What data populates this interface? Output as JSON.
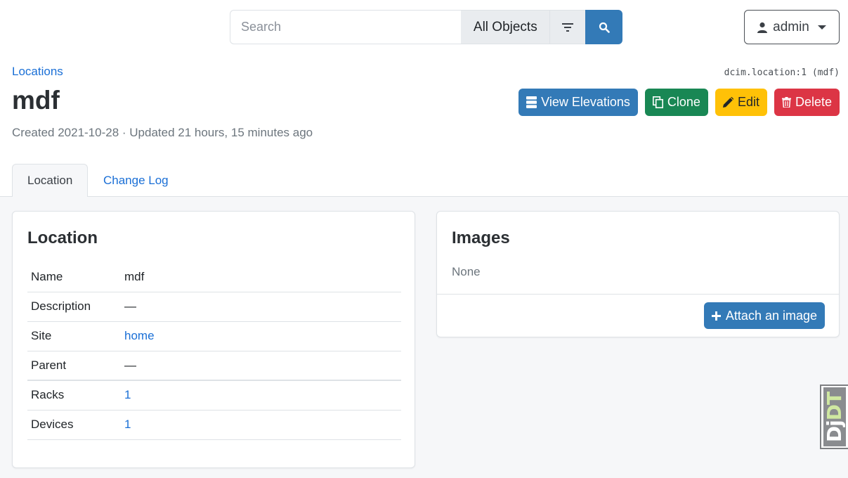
{
  "search": {
    "placeholder": "Search",
    "scope_label": "All Objects"
  },
  "user": {
    "name": "admin"
  },
  "breadcrumb": {
    "label": "Locations"
  },
  "object_id": "dcim.location:1 (mdf)",
  "title": "mdf",
  "meta": "Created 2021-10-28 · Updated 21 hours, 15 minutes ago",
  "actions": {
    "view_elevations": "View Elevations",
    "clone": "Clone",
    "edit": "Edit",
    "delete": "Delete"
  },
  "tabs": [
    {
      "label": "Location",
      "active": true
    },
    {
      "label": "Change Log",
      "active": false
    }
  ],
  "location_card": {
    "title": "Location",
    "rows": [
      {
        "key": "Name",
        "value": "mdf",
        "link": false
      },
      {
        "key": "Description",
        "value": "—",
        "link": false
      },
      {
        "key": "Site",
        "value": "home",
        "link": true
      },
      {
        "key": "Parent",
        "value": "—",
        "link": false
      },
      {
        "key": "Racks",
        "value": "1",
        "link": true
      },
      {
        "key": "Devices",
        "value": "1",
        "link": true
      }
    ]
  },
  "images_card": {
    "title": "Images",
    "empty_text": "None",
    "attach_label": "Attach an image"
  },
  "djdt": {
    "dj": "Dj",
    "dt": "DT"
  },
  "colors": {
    "primary": "#337ab7",
    "success": "#198754",
    "warning": "#ffc107",
    "danger": "#dc3545",
    "link": "#1a6fd6"
  }
}
